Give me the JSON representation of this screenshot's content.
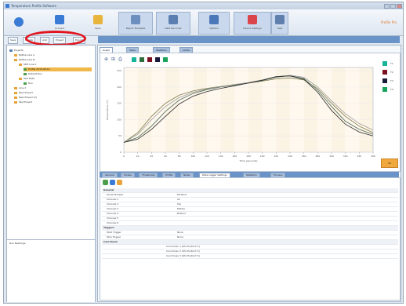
{
  "window": {
    "title": "Temperature Profile Software"
  },
  "ribbon": {
    "buttons": [
      {
        "label": "Connect",
        "color": "#3a7bd5"
      },
      {
        "label": "Open",
        "color": "#e8b43c"
      },
      {
        "label": "Report Template",
        "color": "#6d8fbf"
      },
      {
        "label": "Data Recorder",
        "color": "#5b7fb0"
      },
      {
        "label": "Options",
        "color": "#4a78b8"
      },
      {
        "label": "Device Settings",
        "color": "#d9454a"
      },
      {
        "label": "Help",
        "color": "#5f80ad"
      }
    ],
    "brand": "Profile Pro"
  },
  "toolbar": {
    "buttons": [
      "Save",
      "Delete",
      "Add",
      "Project",
      "Export"
    ]
  },
  "tree": {
    "items": [
      {
        "label": "Projects",
        "level": 0,
        "color": "#5a7fb5"
      },
      {
        "label": "Reflow Line A",
        "level": 1,
        "color": "#e8a43a"
      },
      {
        "label": "Reflow Line B",
        "level": 1,
        "color": "#e8a43a"
      },
      {
        "label": "SMT Line 1",
        "level": 2,
        "color": "#e8a43a"
      },
      {
        "label": "Profile 2014-08-14",
        "level": 3,
        "color": "#4c9e4c",
        "selected": true
      },
      {
        "label": "Default Run",
        "level": 3,
        "color": "#4c9e4c"
      },
      {
        "label": "Test Data",
        "level": 2,
        "color": "#e8a43a"
      },
      {
        "label": "Run",
        "level": 3,
        "color": "#4c9e4c"
      },
      {
        "label": "Line 2",
        "level": 1,
        "color": "#e8a43a"
      },
      {
        "label": "New Project",
        "level": 1,
        "color": "#e8a43a"
      },
      {
        "label": "New Project (2)",
        "level": 1,
        "color": "#e8a43a"
      },
      {
        "label": "Test Project",
        "level": 1,
        "color": "#e8a43a"
      }
    ],
    "bottom_header": "Run Readings"
  },
  "chart_tabs": [
    "Graph View",
    "Table",
    "Statistics",
    "Limits"
  ],
  "chart_toolbar": [
    "zoom-icon",
    "fit-icon",
    "print-icon"
  ],
  "legend": [
    {
      "label": "T1",
      "color": "#18b39b"
    },
    {
      "label": "T2",
      "color": "#7a1020"
    },
    {
      "label": "T3",
      "color": "#1a1a3a"
    },
    {
      "label": "T4",
      "color": "#1aa25a"
    }
  ],
  "chart_legend_top": [
    {
      "color": "#18b39b"
    },
    {
      "color": "#2f6d3a"
    },
    {
      "color": "#7a1020"
    },
    {
      "color": "#1a1a3a"
    },
    {
      "color": "#1aa25a"
    }
  ],
  "chart_action": {
    "label": "OK"
  },
  "chart_data": {
    "type": "line",
    "title": "",
    "xlabel": "Time (seconds)",
    "ylabel": "Temperature (°C)",
    "xlim": [
      0,
      360
    ],
    "ylim": [
      0,
      260
    ],
    "x_ticks": [
      "0",
      "20",
      "40",
      "60",
      "80",
      "100",
      "120",
      "140",
      "160",
      "180",
      "200",
      "220",
      "240",
      "260",
      "280",
      "300",
      "320",
      "340",
      "360"
    ],
    "y_ticks": [
      "0",
      "50",
      "100",
      "150",
      "200",
      "250"
    ],
    "series": [
      {
        "color": "#7b7b4b",
        "x": [
          0,
          20,
          40,
          60,
          80,
          100,
          120,
          140,
          160,
          180,
          200,
          220,
          240,
          260,
          280,
          300,
          320,
          340,
          360
        ],
        "y": [
          30,
          60,
          110,
          150,
          175,
          188,
          196,
          202,
          207,
          212,
          218,
          225,
          228,
          222,
          195,
          150,
          110,
          80,
          60
        ]
      },
      {
        "color": "#4b6b5b",
        "x": [
          0,
          20,
          40,
          60,
          80,
          100,
          120,
          140,
          160,
          180,
          200,
          220,
          240,
          260,
          280,
          300,
          320,
          340,
          360
        ],
        "y": [
          30,
          45,
          80,
          125,
          160,
          180,
          192,
          200,
          206,
          212,
          220,
          230,
          235,
          226,
          190,
          140,
          95,
          70,
          55
        ]
      },
      {
        "color": "#9b9b9b",
        "x": [
          0,
          20,
          40,
          60,
          80,
          100,
          120,
          140,
          160,
          180,
          200,
          220,
          240,
          260,
          280,
          300,
          320,
          340,
          360
        ],
        "y": [
          30,
          55,
          100,
          140,
          168,
          184,
          194,
          201,
          208,
          214,
          222,
          232,
          236,
          230,
          200,
          158,
          118,
          88,
          68
        ]
      },
      {
        "color": "#2b2b2b",
        "x": [
          0,
          20,
          40,
          60,
          80,
          100,
          120,
          140,
          160,
          180,
          200,
          220,
          240,
          260,
          280,
          300,
          320,
          340,
          360
        ],
        "y": [
          30,
          40,
          70,
          110,
          148,
          172,
          186,
          196,
          204,
          212,
          221,
          232,
          234,
          224,
          184,
          128,
          86,
          62,
          50
        ]
      }
    ]
  },
  "bottom_tabs": [
    "General",
    "Probes",
    "Thresholds",
    "Profile",
    "Notes",
    "Data Logger Settings",
    "Statistics",
    "Process"
  ],
  "props": {
    "rows": [
      {
        "k": "General",
        "v": "",
        "cat": true
      },
      {
        "k": "Serial Number",
        "v": "D01614"
      },
      {
        "k": "Channel 1",
        "v": "Air"
      },
      {
        "k": "Channel 2",
        "v": "Top"
      },
      {
        "k": "Channel 3",
        "v": "Middle"
      },
      {
        "k": "Channel 4",
        "v": "Bottom"
      },
      {
        "k": "Channel 5",
        "v": ""
      },
      {
        "k": "Channel 6",
        "v": ""
      },
      {
        "k": "Triggers",
        "v": "",
        "cat": true
      },
      {
        "k": "Start Trigger",
        "v": "None"
      },
      {
        "k": "Stop Trigger",
        "v": "None"
      },
      {
        "k": "Cool Down",
        "v": "",
        "cat": true
      },
      {
        "k": "",
        "v": "Cool Down 1 (65.0%/40.0°C)",
        "mid": true
      },
      {
        "k": "",
        "v": "Cool Down 2 (65.0%/40.0°C)",
        "mid": true
      },
      {
        "k": "",
        "v": "Cool Down 3 (65.0%/40.0°C)",
        "mid": true
      }
    ]
  }
}
